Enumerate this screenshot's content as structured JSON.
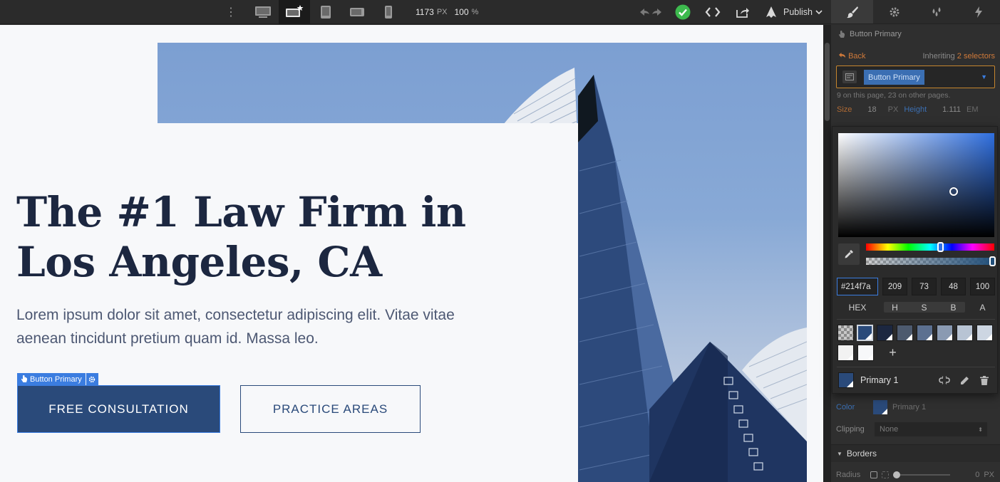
{
  "toolbar": {
    "canvas_width": "1173",
    "canvas_unit": "PX",
    "zoom": "100",
    "zoom_unit": "%",
    "publish_label": "Publish",
    "devices": [
      "desktop-icon",
      "desktop-large-icon",
      "tablet-icon",
      "mobile-landscape-icon",
      "mobile-portrait-icon"
    ]
  },
  "canvas": {
    "title": "The #1 Law Firm in Los Angeles, CA",
    "subtitle": "Lorem ipsum dolor sit amet, consectetur adipiscing elit. Vitae vitae aenean tincidunt pretium quam id. Massa leo.",
    "selected_tag": "Button Primary",
    "primary_button": "FREE CONSULTATION",
    "secondary_button": "PRACTICE AREAS"
  },
  "panel": {
    "selected_element": "Button Primary",
    "back_label": "Back",
    "inheriting_prefix": "Inheriting",
    "inheriting_count": "2 selectors",
    "selector_chip": "Button Primary",
    "usage_text": "9 on this page, 23 on other pages.",
    "size_label": "Size",
    "size_value": "18",
    "size_unit": "PX",
    "height_label": "Height",
    "height_value": "1.111",
    "height_unit": "EM",
    "color_label": "Color",
    "color_value": "Primary 1",
    "clipping_label": "Clipping",
    "clipping_value": "None",
    "borders_label": "Borders",
    "radius_label": "Radius",
    "radius_value": "0",
    "radius_unit": "PX"
  },
  "picker": {
    "hex": "#214f7a",
    "h": "209",
    "s": "73",
    "b": "48",
    "a": "100",
    "label_hex": "HEX",
    "label_h": "H",
    "label_s": "S",
    "label_b": "B",
    "label_a": "A",
    "swatches": [
      "transparent",
      "#2a4a7a",
      "#1c2740",
      "#4d5a6e",
      "#5c7090",
      "#8a9ab2",
      "#b8c4d4",
      "#cdd6e2",
      "#f2f2f2",
      "#f7f8fa"
    ],
    "global_swatch_name": "Primary 1"
  },
  "colors": {
    "accent": "#3b7de0",
    "primary": "#214f7a",
    "navy": "#1c2740",
    "success": "#3dba4e",
    "selector_orange": "#c6862e"
  }
}
